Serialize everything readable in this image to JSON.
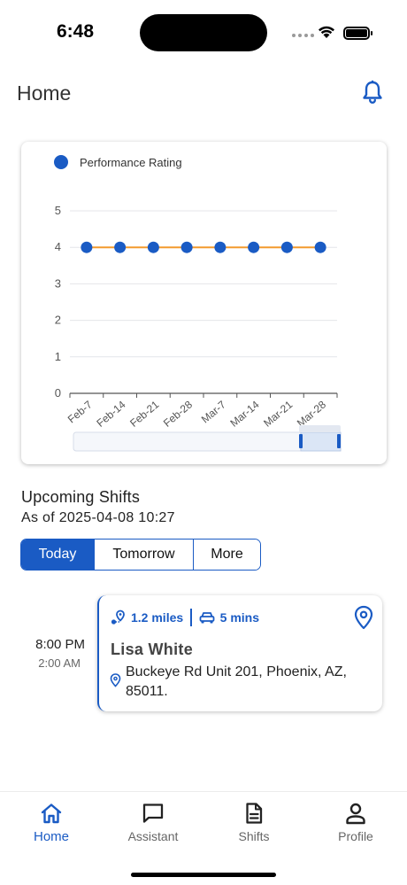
{
  "status_bar": {
    "time": "6:48"
  },
  "header": {
    "title": "Home"
  },
  "chart_data": {
    "type": "line",
    "legend": "Performance Rating",
    "categories": [
      "Feb-7",
      "Feb-14",
      "Feb-21",
      "Feb-28",
      "Mar-7",
      "Mar-14",
      "Mar-21",
      "Mar-28"
    ],
    "series": [
      {
        "name": "Performance Rating",
        "values": [
          4,
          4,
          4,
          4,
          4,
          4,
          4,
          4
        ]
      }
    ],
    "yticks": [
      "0",
      "1",
      "2",
      "3",
      "4",
      "5"
    ],
    "ylim": [
      0,
      5
    ],
    "grid": true,
    "legend_position": "top-left",
    "colors": {
      "point": "#1a5bc4",
      "line": "#f39a2e",
      "grid": "#e4e6ea",
      "axis": "#555555",
      "slider": "#dbe6f6"
    }
  },
  "shifts": {
    "title": "Upcoming Shifts",
    "as_of": "As of 2025-04-08 10:27",
    "tabs": [
      {
        "label": "Today",
        "active": true
      },
      {
        "label": "Tomorrow",
        "active": false
      },
      {
        "label": "More",
        "active": false
      }
    ],
    "items": [
      {
        "start": "8:00 PM",
        "end": "2:00 AM",
        "distance": "1.2 miles",
        "drive_time": "5 mins",
        "client": "Lisa White",
        "address": "Buckeye Rd Unit 201, Phoenix, AZ, 85011."
      }
    ]
  },
  "nav": {
    "items": [
      {
        "label": "Home",
        "icon": "home-icon",
        "active": true
      },
      {
        "label": "Assistant",
        "icon": "chat-icon",
        "active": false
      },
      {
        "label": "Shifts",
        "icon": "document-icon",
        "active": false
      },
      {
        "label": "Profile",
        "icon": "person-icon",
        "active": false
      }
    ]
  },
  "colors": {
    "accent": "#1a5bc4"
  }
}
